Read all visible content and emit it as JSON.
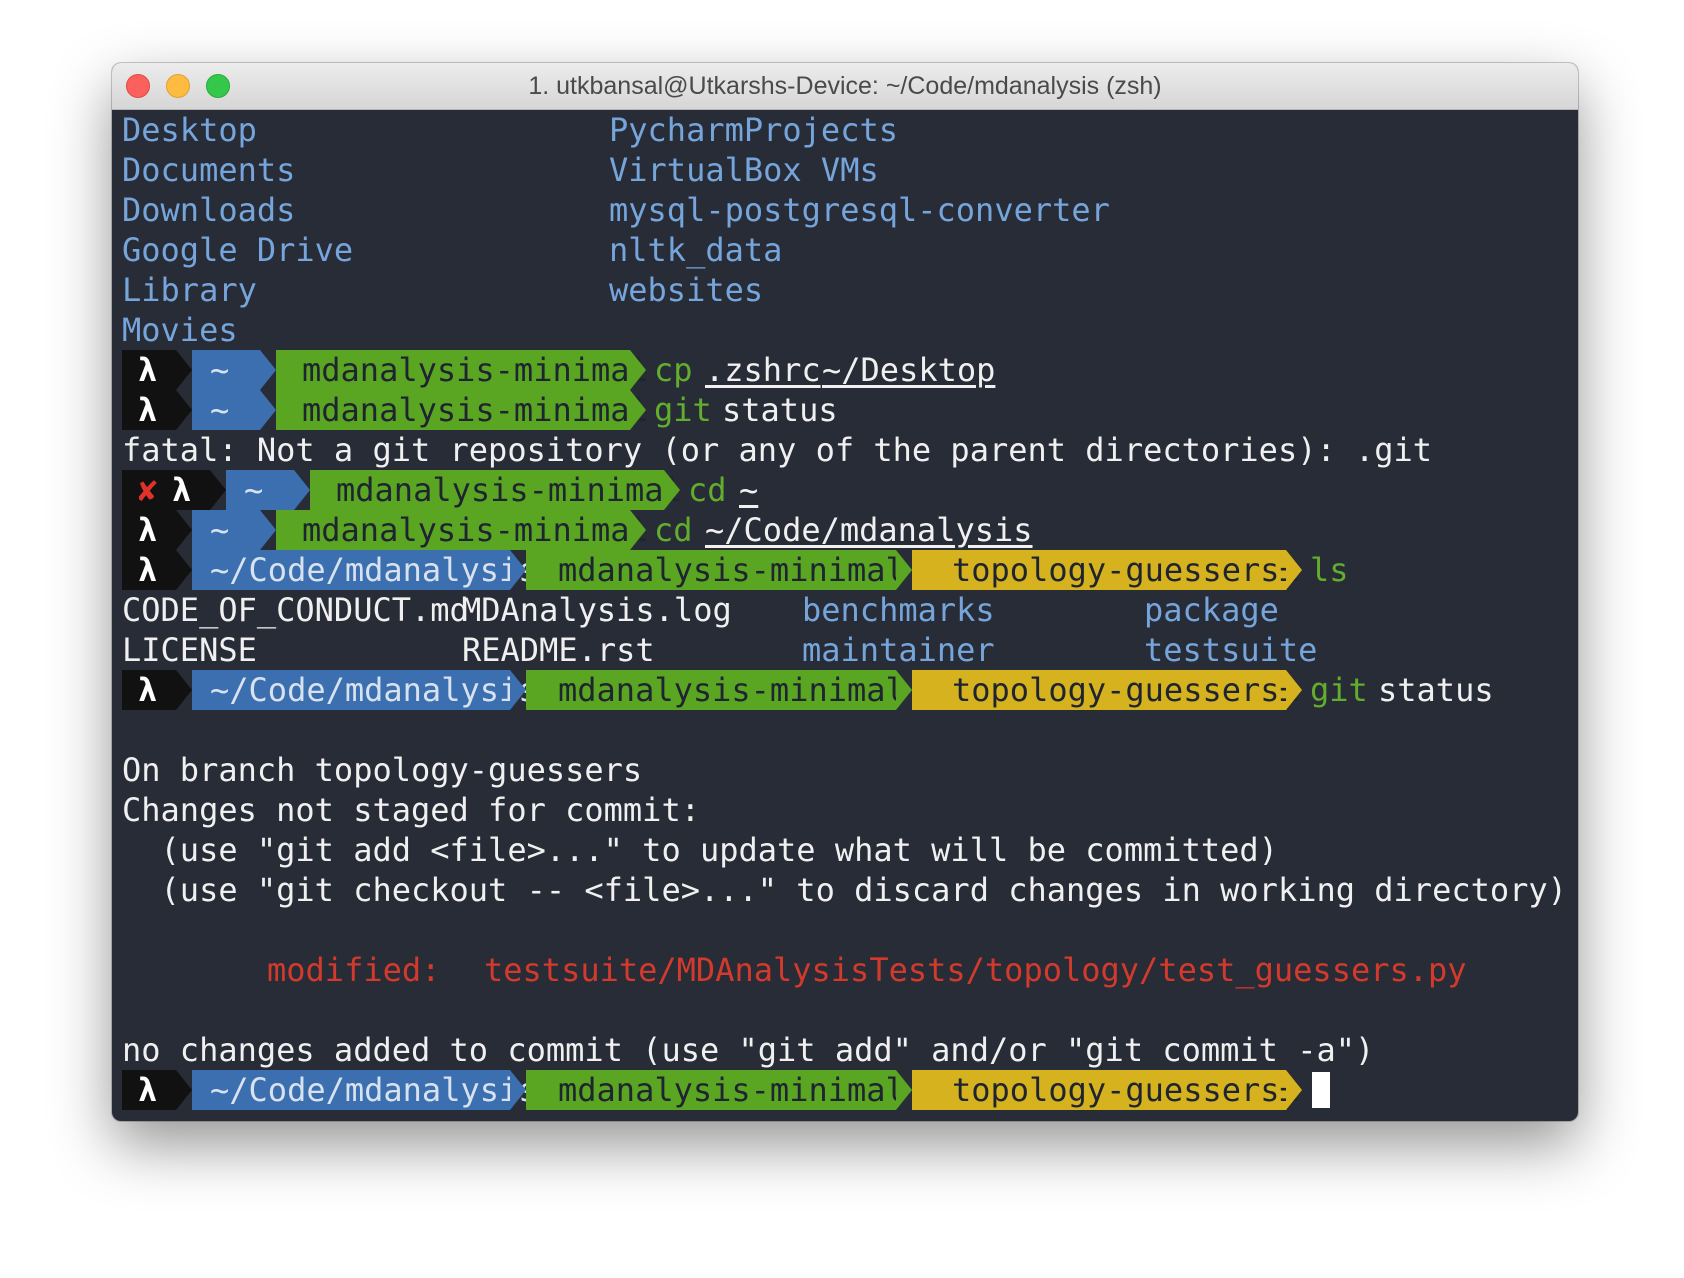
{
  "window": {
    "title": "1. utkbansal@Utkarshs-Device: ~/Code/mdanalysis (zsh)"
  },
  "colors": {
    "background": "#282c37",
    "segment_black": "#111111",
    "segment_blue": "#3b6fb0",
    "segment_green": "#5aa522",
    "segment_yellow": "#d6b21f",
    "dir_text": "#76a5dc",
    "command_green": "#63ad2d",
    "modified_red": "#d33a2c"
  },
  "ls_home": {
    "col1": [
      "Desktop",
      "Documents",
      "Downloads",
      "Google Drive",
      "Library",
      "Movies"
    ],
    "col2": [
      "PycharmProjects",
      "VirtualBox VMs",
      "mysql-postgresql-converter",
      "nltk_data",
      "websites"
    ]
  },
  "prompt": {
    "lambda": "λ",
    "error_mark": "✘",
    "home": "~",
    "virtualenv": "mdanalysis-minimal",
    "path": "~/Code/mdanalysis",
    "branch_icon": "",
    "branch": "topology-guessers±"
  },
  "commands": {
    "c1_cmd": "cp",
    "c1_arg1": ".zshrc",
    "c1_arg2": "~/Desktop",
    "c2_cmd": "git",
    "c2_arg": "status",
    "c3_cmd": "cd",
    "c3_arg": "~",
    "c4_cmd": "cd",
    "c4_arg": "~/Code/mdanalysis",
    "c5_cmd": "ls",
    "c6_cmd": "git",
    "c6_arg": "status"
  },
  "outputs": {
    "fatal": "fatal: Not a git repository (or any of the parent directories): .git",
    "ls_files": [
      "CODE_OF_CONDUCT.md",
      "LICENSE",
      "MDAnalysis.log",
      "README.rst"
    ],
    "ls_dirs": [
      "benchmarks",
      "maintainer",
      "package",
      "testsuite"
    ],
    "git_status": {
      "on_branch": "On branch topology-guessers",
      "not_staged": "Changes not staged for commit:",
      "hint1": "  (use \"git add <file>...\" to update what will be committed)",
      "hint2": "  (use \"git checkout -- <file>...\" to discard changes in working directory)",
      "modified_label": "modified:",
      "modified_file": "testsuite/MDAnalysisTests/topology/test_guessers.py",
      "footer": "no changes added to commit (use \"git add\" and/or \"git commit -a\")"
    }
  }
}
